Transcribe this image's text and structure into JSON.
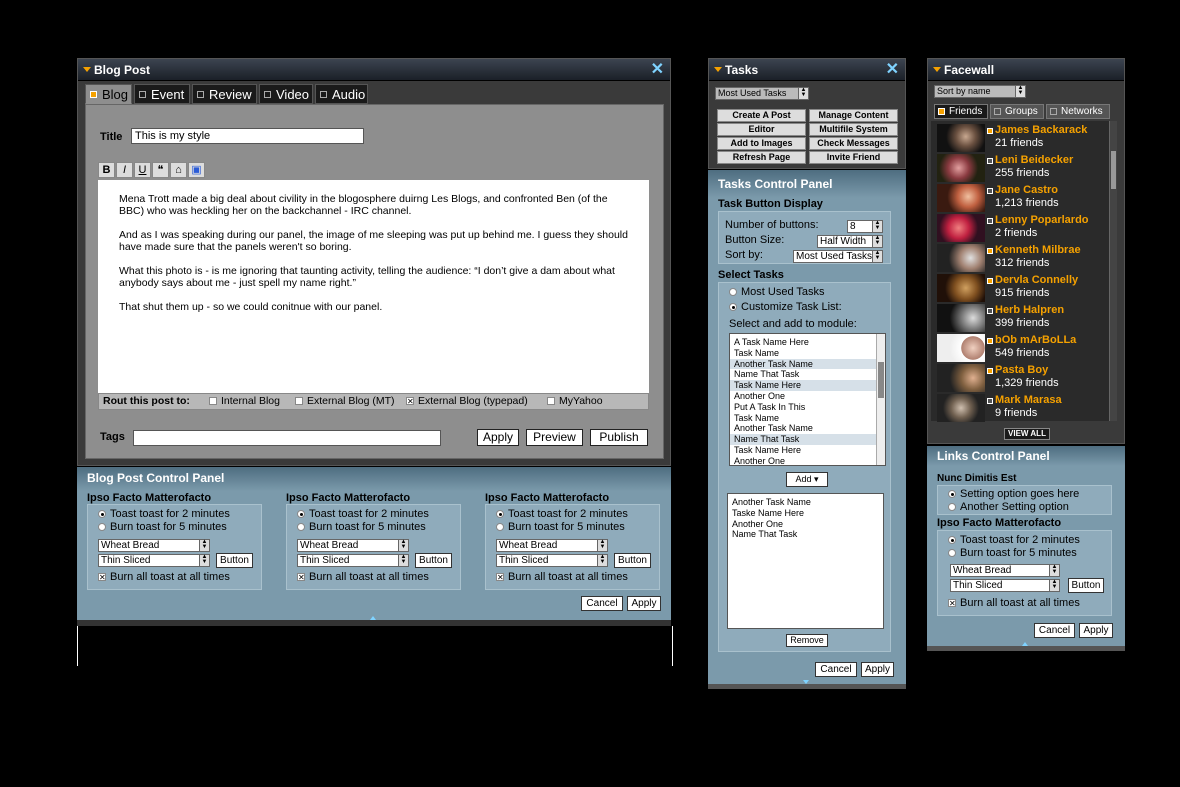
{
  "blog": {
    "title": "Blog Post",
    "tabs": [
      "Blog",
      "Event",
      "Review",
      "Video",
      "Audio"
    ],
    "title_label": "Title",
    "title_value": "This is my style",
    "toolbar": [
      "B",
      "I",
      "U",
      "❝",
      "⌂",
      "▣"
    ],
    "body": [
      "Mena Trott made a big deal about civility in the blogosphere duirng Les Blogs, and confronted Ben (of the BBC) who was heckling her on the backchannel - IRC channel.",
      "And as I was speaking during our panel, the image of me sleeping was put up behind me. I guess they should have made sure that the panels weren't so boring.",
      "What this photo is - is me ignoring that taunting activity, telling the audience: “I don’t give a dam about what anybody says about me - just spell my name right.”",
      "That shut them up - so we could conitnue with our panel."
    ],
    "rout_label": "Rout this post to:",
    "rout_options": [
      {
        "label": "Internal Blog",
        "checked": false
      },
      {
        "label": "External Blog (MT)",
        "checked": false
      },
      {
        "label": "External Blog (typepad)",
        "checked": true
      },
      {
        "label": "MyYahoo",
        "checked": false
      }
    ],
    "tags_label": "Tags",
    "tags_value": "",
    "buttons": {
      "apply": "Apply",
      "preview": "Preview",
      "publish": "Publish"
    }
  },
  "blog_cp": {
    "title": "Blog Post Control Panel",
    "columns": [
      {
        "heading": "Ipso Facto Matterofacto",
        "radio1": "Toast toast for 2 minutes",
        "radio2": "Burn toast for 5 minutes",
        "select1": "Wheat Bread",
        "select2": "Thin Sliced",
        "button": "Button",
        "check": "Burn all toast at all times"
      },
      {
        "heading": "Ipso Facto Matterofacto",
        "radio1": "Toast toast for 2 minutes",
        "radio2": "Burn toast for 5 minutes",
        "select1": "Wheat Bread",
        "select2": "Thin Sliced",
        "button": "Button",
        "check": "Burn all toast at all times"
      },
      {
        "heading": "Ipso Facto Matterofacto",
        "radio1": "Toast toast for 2 minutes",
        "radio2": "Burn toast for 5 minutes",
        "select1": "Wheat Bread",
        "select2": "Thin Sliced",
        "button": "Button",
        "check": "Burn all toast at all times"
      }
    ],
    "cancel": "Cancel",
    "apply": "Apply"
  },
  "tasks": {
    "title": "Tasks",
    "dropdown": "Most Used Tasks",
    "buttons": [
      "Create A Post",
      "Manage Content",
      "Editor",
      "Multifile System",
      "Add to Images",
      "Check Messages",
      "Refresh Page",
      "Invite Friend"
    ],
    "cp_title": "Tasks Control Panel",
    "display_heading": "Task Button Display",
    "num_label": "Number of buttons:",
    "num_value": "8",
    "size_label": "Button Size:",
    "size_value": "Half Width",
    "sort_label": "Sort by:",
    "sort_value": "Most Used Tasks",
    "select_heading": "Select Tasks",
    "opt1": "Most Used Tasks",
    "opt2": "Customize Task List:",
    "add_label": "Select and add to module:",
    "list": [
      "A Task Name Here",
      "Task Name",
      "Another Task Name",
      "Name That Task",
      "Task Name Here",
      "Another One",
      "Put A Task In This",
      "Task Name",
      "Another Task Name",
      "Name That Task",
      "Task Name Here",
      "Another One"
    ],
    "add_button": "Add",
    "selected": [
      "Another Task Name",
      "Taske Name Here",
      "Another One",
      "Name That Task"
    ],
    "remove": "Remove",
    "cancel": "Cancel",
    "apply": "Apply"
  },
  "facewall": {
    "title": "Facewall",
    "sort": "Sort by name",
    "tabs": [
      "Friends",
      "Groups",
      "Networks"
    ],
    "friends": [
      {
        "name": "James Backarack",
        "count": "21 friends"
      },
      {
        "name": "Leni Beidecker",
        "count": "255 friends"
      },
      {
        "name": "Jane Castro",
        "count": "1,213 friends"
      },
      {
        "name": "Lenny Poparlardo",
        "count": "2 friends"
      },
      {
        "name": "Kenneth Milbrae",
        "count": "312 friends"
      },
      {
        "name": "Dervla Connelly",
        "count": "915 friends"
      },
      {
        "name": "Herb Halpren",
        "count": "399 friends"
      },
      {
        "name": "bOb mArBoLLa",
        "count": "549 friends"
      },
      {
        "name": "Pasta Boy",
        "count": "1,329 friends"
      },
      {
        "name": "Mark Marasa",
        "count": "9 friends"
      }
    ],
    "view_all": "VIEW ALL",
    "cp_title": "Links Control Panel",
    "nunc_heading": "Nunc Dimitis Est",
    "nunc1": "Setting option goes here",
    "nunc2": "Another Setting option",
    "ipso_heading": "Ipso Facto Matterofacto",
    "radio1": "Toast toast for 2 minutes",
    "radio2": "Burn toast for 5 minutes",
    "select1": "Wheat Bread",
    "select2": "Thin Sliced",
    "button": "Button",
    "check": "Burn all toast at all times",
    "cancel": "Cancel",
    "apply": "Apply"
  }
}
